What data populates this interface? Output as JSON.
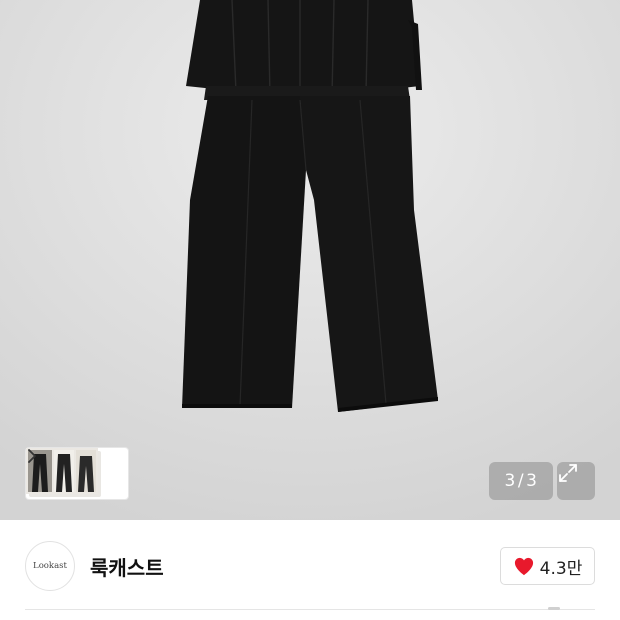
{
  "gallery": {
    "current_page": "3",
    "separator": "/",
    "total_pages": "3",
    "thumbnail_count": 3,
    "expand_icon": "expand-arrows-icon",
    "next_icon": "chevron-right-icon"
  },
  "seller": {
    "avatar_text": "Lookast",
    "store_name": "룩캐스트"
  },
  "like": {
    "icon": "heart-icon",
    "icon_color": "#e8192c",
    "count": "4.3만"
  },
  "colors": {
    "image_bg": "#d9d9d9",
    "garment": "#141414"
  }
}
